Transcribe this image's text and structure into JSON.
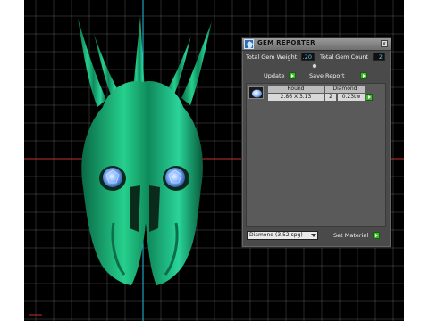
{
  "viewport": {
    "name": "3d-viewport",
    "model": "jeweled-mask-model"
  },
  "panel": {
    "title": "Gem Reporter",
    "close_label": "x",
    "total_weight_label": "Total Gem Weight",
    "total_weight_value": ".20",
    "total_count_label": "Total Gem Count",
    "total_count_value": "2",
    "update_label": "Update",
    "save_report_label": "Save Report",
    "table": {
      "headers": [
        "Round",
        "Diamond"
      ],
      "rows": [
        {
          "size": "2.86 X 3.13",
          "count": "2",
          "weight": "0.23tw"
        }
      ]
    },
    "material_select": "Diamond   (3.52 spg)",
    "set_material_label": "Set Material"
  },
  "colors": {
    "viewport_bg": "#000000",
    "grid": "#ffffff",
    "gem_green": "#1fbf7a",
    "gem_blue": "#7fb2ff",
    "panel_bg": "#4a4a4a",
    "accent_value": "#5fd0ff",
    "button_green": "#3dbb2b"
  }
}
